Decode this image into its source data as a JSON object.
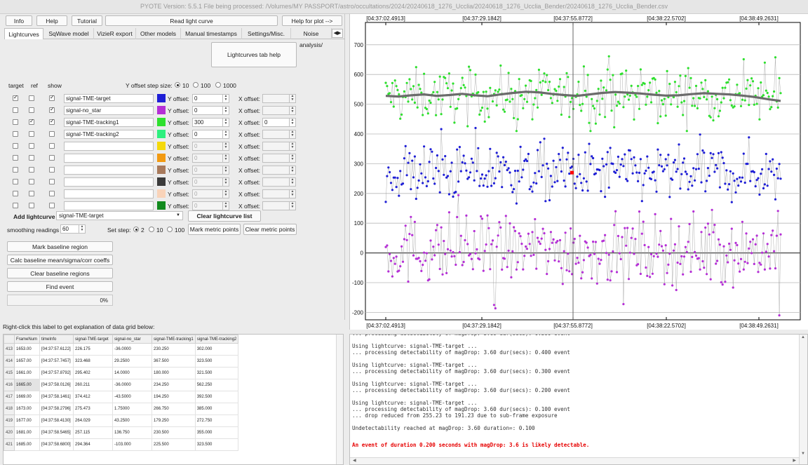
{
  "window": {
    "title": "PYOTE Version: 5.5.1  File being processed: /Volumes/MY PASSPORT/astro/occultations/2024/20240618_1276_Ucclia/20240618_1276_Ucclia_Bender/20240618_1276_Ucclia_Bender.csv"
  },
  "toolbar": {
    "info": "Info",
    "help": "Help",
    "tutorial": "Tutorial",
    "read_light_curve": "Read light curve",
    "help_for_plot": "Help for plot -->"
  },
  "tabs": [
    "Lightcurves",
    "SqWave model",
    "VizieR export",
    "Other models",
    "Manual timestamps",
    "Settings/Misc.",
    "Noise analysis/"
  ],
  "tab_scroll": "◀▶",
  "lightcurves_tab_help": "Lightcurves tab help",
  "columns": {
    "target": "target",
    "ref": "ref",
    "show": "show"
  },
  "y_offset_step": {
    "label": "Y offset step size:",
    "options": [
      "10",
      "100",
      "1000"
    ],
    "selected": "10"
  },
  "curves": [
    {
      "target": true,
      "ref": false,
      "show": true,
      "name": "signal-TME-target",
      "color": "#1f1fd6",
      "y_offset": "0",
      "x_offset": "",
      "x_enabled": false
    },
    {
      "target": false,
      "ref": false,
      "show": true,
      "name": "signal-no_star",
      "color": "#b52fd6",
      "y_offset": "0",
      "x_offset": "",
      "x_enabled": false
    },
    {
      "target": false,
      "ref": true,
      "show": true,
      "name": "signal-TME-tracking1",
      "color": "#2ee02e",
      "y_offset": "300",
      "x_offset": "0",
      "x_enabled": true
    },
    {
      "target": false,
      "ref": false,
      "show": false,
      "name": "signal-TME-tracking2",
      "color": "#2ef07f",
      "y_offset": "0",
      "x_offset": "",
      "x_enabled": false
    },
    {
      "target": false,
      "ref": false,
      "show": false,
      "name": "",
      "color": "#f5d90a",
      "y_offset": "0",
      "x_offset": "",
      "x_enabled": false
    },
    {
      "target": false,
      "ref": false,
      "show": false,
      "name": "",
      "color": "#f29a12",
      "y_offset": "0",
      "x_offset": "",
      "x_enabled": false
    },
    {
      "target": false,
      "ref": false,
      "show": false,
      "name": "",
      "color": "#a87a5c",
      "y_offset": "0",
      "x_offset": "",
      "x_enabled": false
    },
    {
      "target": false,
      "ref": false,
      "show": false,
      "name": "",
      "color": "#3b3b3b",
      "y_offset": "0",
      "x_offset": "",
      "x_enabled": false
    },
    {
      "target": false,
      "ref": false,
      "show": false,
      "name": "",
      "color": "#f9d3b9",
      "y_offset": "0",
      "x_offset": "",
      "x_enabled": false
    },
    {
      "target": false,
      "ref": false,
      "show": false,
      "name": "",
      "color": "#118a1d",
      "y_offset": "0",
      "x_offset": "",
      "x_enabled": false
    }
  ],
  "y_offset_label": "Y offset:",
  "x_offset_label": "X offset:",
  "add_lightcurve": {
    "label": "Add lightcurve",
    "value": "signal-TME-target"
  },
  "clear_lightcurve_list": "Clear lightcurve list",
  "smoothing": {
    "label": "smoothing readings",
    "value": "60"
  },
  "set_step": {
    "label": "Set step:",
    "options": [
      "2",
      "10",
      "100"
    ],
    "selected": "2"
  },
  "mark_metric_points": "Mark metric points",
  "clear_metric_points": "Clear metric points",
  "mark_baseline_region": "Mark baseline region",
  "calc_baseline": "Calc baseline mean/sigma/corr coeffs",
  "clear_baseline_regions": "Clear baseline regions",
  "find_event": "Find event",
  "progress": {
    "value": 0,
    "text": "0%"
  },
  "grid_hint": "Right-click this label to get explanation of data grid below:",
  "grid": {
    "headers": [
      "",
      "FrameNum",
      "timeInfo",
      "signal-TME-target",
      "signal-no_star",
      "signal-TME-tracking1",
      "signal-TME-tracking2"
    ],
    "rows": [
      [
        "413",
        "1653.00",
        "[04:37:57.6122]",
        "226.175",
        "-36.0000",
        "230.250",
        "302.000"
      ],
      [
        "414",
        "1657.00",
        "[04:37:57.7457]",
        "323.468",
        "29.2500",
        "367.500",
        "323.500"
      ],
      [
        "415",
        "1661.00",
        "[04:37:57.8792]",
        "295.402",
        "14.0000",
        "180.000",
        "321.500"
      ],
      [
        "416",
        "1665.00",
        "[04:37:58.0126]",
        "260.211",
        "-36.0000",
        "234.250",
        "562.250"
      ],
      [
        "417",
        "1669.00",
        "[04:37:58.1461]",
        "374.412",
        "-43.5000",
        "194.250",
        "392.500"
      ],
      [
        "418",
        "1673.00",
        "[04:37:58.2796]",
        "275.473",
        "1.75000",
        "266.750",
        "385.000"
      ],
      [
        "419",
        "1677.00",
        "[04:37:58.4130]",
        "264.029",
        "43.2500",
        "179.250",
        "272.750"
      ],
      [
        "420",
        "1681.00",
        "[04:37:58.5465]",
        "257.115",
        "136.750",
        "230.500",
        "355.000"
      ],
      [
        "421",
        "1685.00",
        "[04:37:58.6800]",
        "294.364",
        "-103.000",
        "225.500",
        "323.500"
      ]
    ]
  },
  "log": {
    "lines": [
      "... processing detectability of magDrop: 3.60 dur(secs): 0.500 event",
      "",
      "Using lightcurve: signal-TME-target ...",
      "... processing detectability of magDrop: 3.60 dur(secs): 0.400 event",
      "",
      "Using lightcurve: signal-TME-target ...",
      "... processing detectability of magDrop: 3.60 dur(secs): 0.300 event",
      "",
      "Using lightcurve: signal-TME-target ...",
      "... processing detectability of magDrop: 3.60 dur(secs): 0.200 event",
      "",
      "Using lightcurve: signal-TME-target ...",
      "... processing detectability of magDrop: 3.60 dur(secs): 0.100 event",
      "... drop reduced from 255.23 to 191.23 due to sub-frame exposure",
      "",
      "Undetectability reached at magDrop: 3.60 duration=: 0.100",
      ""
    ],
    "result": "An event of duration 0.200 seconds with magDrop: 3.6 is likely detectable."
  },
  "chart_data": {
    "type": "scatter",
    "x_tick_labels": [
      "[04:37:02.4913]",
      "[04:37:29.1842]",
      "[04:37:55.8772]",
      "[04:38:22.5702]",
      "[04:38:49.2631]"
    ],
    "y_ticks": [
      -200,
      -100,
      0,
      100,
      200,
      300,
      400,
      500,
      600,
      700
    ],
    "ylim": [
      -225,
      775
    ],
    "grid": true,
    "cursor_time": "[04:37:55.8772]",
    "series": [
      {
        "color": "#2ee02e",
        "mean": 530,
        "spread": 42,
        "min": 410,
        "max": 735,
        "smooth": [
          528,
          526,
          530,
          533,
          528,
          531,
          535,
          530,
          527,
          533,
          538,
          542,
          540,
          535,
          531,
          528,
          533,
          538,
          541,
          539,
          536,
          532,
          529,
          530,
          534,
          537,
          535,
          533,
          529,
          524,
          517,
          511
        ]
      },
      {
        "color": "#1f1fd6",
        "mean": 270,
        "spread": 48,
        "min": 150,
        "max": 420
      },
      {
        "color": "#b52fd6",
        "mean": 10,
        "spread": 58,
        "min": -210,
        "max": 205
      }
    ],
    "highlight_point": {
      "value": 270,
      "color": "#ff0000"
    }
  }
}
